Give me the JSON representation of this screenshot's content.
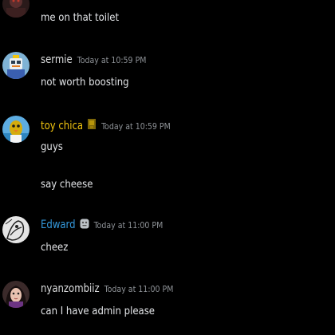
{
  "colors": {
    "background": "#000000",
    "text": "#e3e5e8",
    "timestamp": "#8e9297",
    "toy_chica": "#f1c40f",
    "edward": "#3498db"
  },
  "messages": [
    {
      "username": "",
      "timestamp": "",
      "lines": [
        "me on that toilet"
      ],
      "avatar_icon": "dark-avatar-icon"
    },
    {
      "username": "sermie",
      "timestamp": "Today at 10:59 PM",
      "lines": [
        "not worth boosting"
      ],
      "avatar_icon": "robot-avatar-icon"
    },
    {
      "username": "toy chica",
      "timestamp": "Today at 10:59 PM",
      "lines": [
        "guys",
        "say cheese"
      ],
      "avatar_icon": "chick-avatar-icon",
      "badge_icon": "trophy-icon"
    },
    {
      "username": "Edward",
      "timestamp": "Today at 11:00 PM",
      "lines": [
        "cheez"
      ],
      "avatar_icon": "sketch-avatar-icon",
      "badge_icon": "bot-badge-icon"
    },
    {
      "username": "nyanzombiiz",
      "timestamp": "Today at 11:00 PM",
      "lines": [
        "can I have admin please"
      ],
      "avatar_icon": "girl-avatar-icon"
    }
  ]
}
